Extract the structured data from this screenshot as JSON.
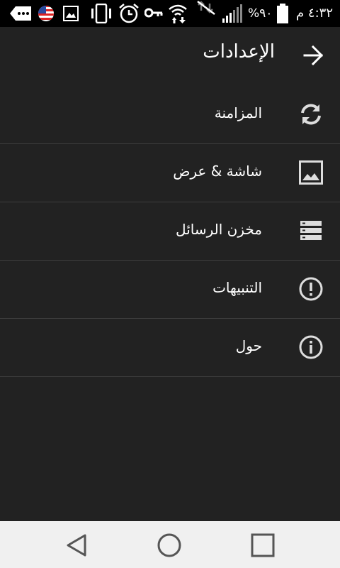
{
  "status_bar": {
    "time": "٤:٣٢ م",
    "battery_percent": "%٩٠",
    "icons": [
      "more-icon",
      "us-flag-icon",
      "image-icon",
      "vibrate-icon",
      "alarm-icon",
      "vpn-key-icon",
      "wifi-icon",
      "no-data-icon",
      "signal-icon",
      "battery-icon"
    ]
  },
  "toolbar": {
    "title": "الإعدادات",
    "back_icon": "arrow-back-icon"
  },
  "settings": {
    "items": [
      {
        "label": "المزامنة",
        "icon": "sync-icon"
      },
      {
        "label": "شاشة & عرض",
        "icon": "image-icon"
      },
      {
        "label": "مخزن الرسائل",
        "icon": "storage-icon"
      },
      {
        "label": "التنبيهات",
        "icon": "alert-icon"
      },
      {
        "label": "حول",
        "icon": "info-icon"
      }
    ]
  },
  "nav_bar": {
    "buttons": [
      "back-triangle-icon",
      "home-circle-icon",
      "recents-square-icon"
    ]
  },
  "colors": {
    "background": "#222222",
    "status_bar": "#000000",
    "divider": "#3e3e3e",
    "nav_bar": "#f0f0f0",
    "nav_icons": "#555555"
  }
}
